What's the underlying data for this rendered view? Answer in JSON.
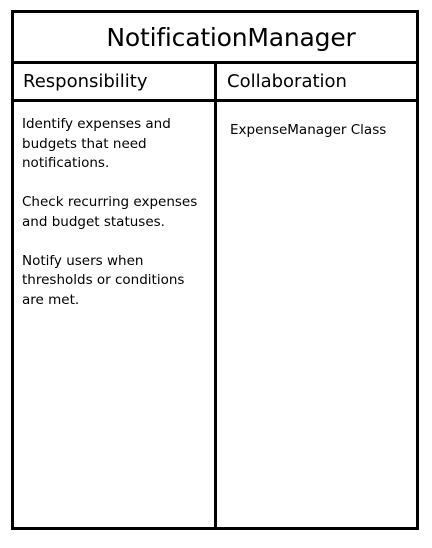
{
  "card": {
    "title": "NotificationManager",
    "responsibility_header": "Responsibility",
    "collaboration_header": "Collaboration",
    "responsibilities": [
      "Identify expenses and budgets that need notifications.",
      "Check recurring expenses and budget statuses.",
      "Notify users when thresholds or conditions are met."
    ],
    "collaborators": [
      "ExpenseManager Class"
    ]
  }
}
